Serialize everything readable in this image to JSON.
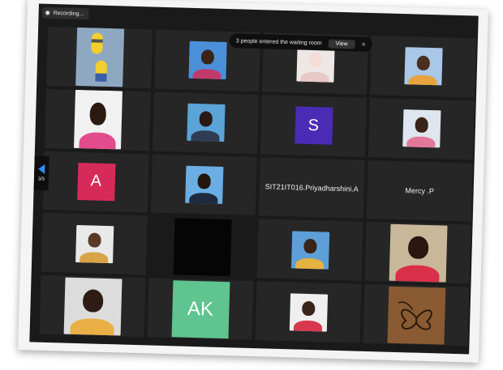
{
  "recording": {
    "label": "Recording..."
  },
  "notification": {
    "text": "3 people entered the waiting room",
    "view_label": "View",
    "close": "×"
  },
  "pager": {
    "current": "3/5"
  },
  "tiles": {
    "r3c3": {
      "name": "SIT21IT016.Priyadharshini.A"
    },
    "r3c4": {
      "name": "Mercy .P"
    },
    "r2c3": {
      "initials": "S",
      "color": "#4a2bb5"
    },
    "r3c1": {
      "initials": "A",
      "color": "#d62b5a"
    },
    "r5c2": {
      "initials": "AK",
      "color": "#5fc48f"
    }
  }
}
